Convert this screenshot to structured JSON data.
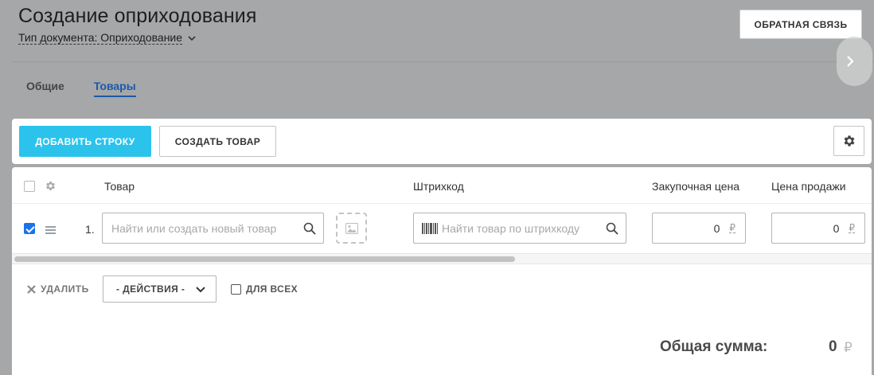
{
  "header": {
    "title": "Создание оприходования",
    "doc_type": "Тип документа: Оприходование",
    "feedback_label": "ОБРАТНАЯ СВЯЗЬ"
  },
  "tabs": [
    {
      "label": "Общие",
      "active": false
    },
    {
      "label": "Товары",
      "active": true
    }
  ],
  "toolbar": {
    "add_row_label": "ДОБАВИТЬ СТРОКУ",
    "create_product_label": "СОЗДАТЬ ТОВАР",
    "settings_icon": "gear-icon"
  },
  "table": {
    "columns": [
      "Товар",
      "Штрихкод",
      "Закупочная цена",
      "Цена продажи"
    ],
    "rows": [
      {
        "checked": true,
        "number": "1.",
        "product_placeholder": "Найти или создать новый товар",
        "barcode_placeholder": "Найти товар по штрихкоду",
        "purchase_price": "0",
        "sale_price": "0",
        "currency": "₽"
      }
    ]
  },
  "actions": {
    "delete_label": "УДАЛИТЬ",
    "select_value": "- ДЕЙСТВИЯ -",
    "for_all_label": "ДЛЯ ВСЕХ"
  },
  "summary": {
    "total_label": "Общая сумма:",
    "total_value": "0",
    "currency": "₽"
  },
  "colors": {
    "accent": "#2bc3ec",
    "tab_active": "#1b5aa8",
    "checkbox": "#1a73e8"
  }
}
